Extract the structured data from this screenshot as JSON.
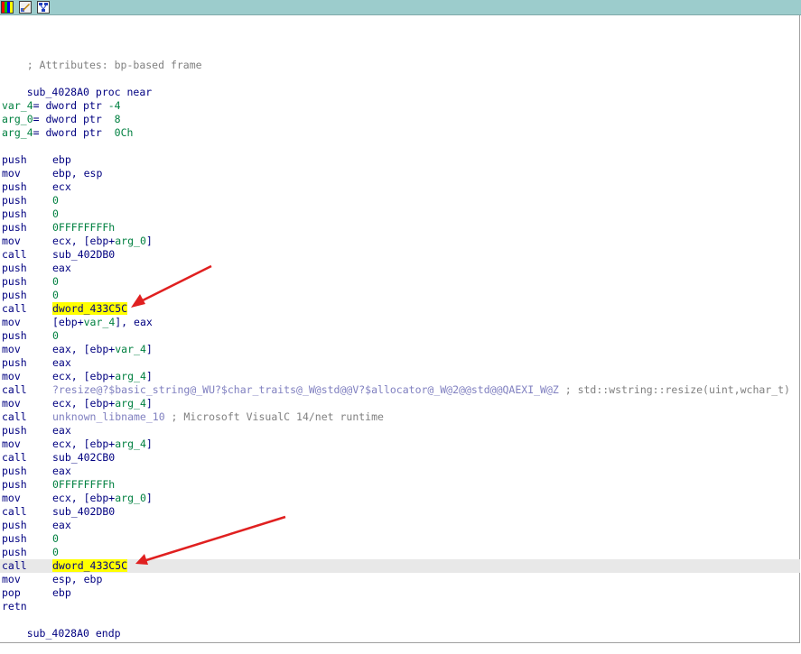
{
  "toolbar": {
    "buttons": [
      "graph-palette-icon",
      "edit-graph-icon",
      "graph-overview-icon"
    ]
  },
  "colors": {
    "toolbar_bg": "#9ccccc",
    "highlight": "#ffff00",
    "instruction": "#000080",
    "variable": "#008040",
    "library_call": "#8080c0",
    "comment": "#808080",
    "annotation_arrow": "#e02020",
    "selected_row": "#e8e8e8"
  },
  "listing": {
    "attributes_comment": "; Attributes: bp-based frame",
    "proc_name": "sub_4028A0",
    "proc_keyword": "proc near",
    "vars": [
      {
        "name": "var_4",
        "decl": "= dword ptr ",
        "off": "-4"
      },
      {
        "name": "arg_0",
        "decl": "= dword ptr ",
        "off": " 8"
      },
      {
        "name": "arg_4",
        "decl": "= dword ptr ",
        "off": " 0Ch"
      }
    ],
    "instructions": [
      {
        "m": "push",
        "op": "ebp"
      },
      {
        "m": "mov",
        "op": "ebp, esp"
      },
      {
        "m": "push",
        "op": "ecx"
      },
      {
        "m": "push",
        "num": "0"
      },
      {
        "m": "push",
        "num": "0"
      },
      {
        "m": "push",
        "num": "0FFFFFFFFh"
      },
      {
        "m": "mov",
        "pre": "ecx, [ebp+",
        "var": "arg_0",
        "post": "]"
      },
      {
        "m": "call",
        "op": "sub_402DB0"
      },
      {
        "m": "push",
        "op": "eax"
      },
      {
        "m": "push",
        "num": "0"
      },
      {
        "m": "push",
        "num": "0"
      },
      {
        "m": "call",
        "sym": "dword_433C5C"
      },
      {
        "m": "mov",
        "pre": "[ebp+",
        "var": "var_4",
        "post": "], eax"
      },
      {
        "m": "push",
        "num": "0"
      },
      {
        "m": "mov",
        "pre": "eax, [ebp+",
        "var": "var_4",
        "post": "]"
      },
      {
        "m": "push",
        "op": "eax"
      },
      {
        "m": "mov",
        "pre": "ecx, [ebp+",
        "var": "arg_4",
        "post": "]"
      },
      {
        "m": "call",
        "lib": "?resize@?$basic_string@_WU?$char_traits@_W@std@@V?$allocator@_W@2@@std@@QAEXI_W@Z",
        "cmt": " ; std::wstring::resize(uint,wchar_t)"
      },
      {
        "m": "mov",
        "pre": "ecx, [ebp+",
        "var": "arg_4",
        "post": "]"
      },
      {
        "m": "call",
        "lib": "unknown_libname_10",
        "cmt": " ; Microsoft VisualC 14/net runtime"
      },
      {
        "m": "push",
        "op": "eax"
      },
      {
        "m": "mov",
        "pre": "ecx, [ebp+",
        "var": "arg_4",
        "post": "]"
      },
      {
        "m": "call",
        "op": "sub_402CB0"
      },
      {
        "m": "push",
        "op": "eax"
      },
      {
        "m": "push",
        "num": "0FFFFFFFFh"
      },
      {
        "m": "mov",
        "pre": "ecx, [ebp+",
        "var": "arg_0",
        "post": "]"
      },
      {
        "m": "call",
        "op": "sub_402DB0"
      },
      {
        "m": "push",
        "op": "eax"
      },
      {
        "m": "push",
        "num": "0"
      },
      {
        "m": "push",
        "num": "0"
      },
      {
        "m": "call",
        "sym": "dword_433C5C",
        "selected": true
      },
      {
        "m": "mov",
        "op": "esp, ebp"
      },
      {
        "m": "pop",
        "op": "ebp"
      },
      {
        "m": "retn",
        "op": ""
      }
    ],
    "endp": "sub_4028A0 endp"
  }
}
